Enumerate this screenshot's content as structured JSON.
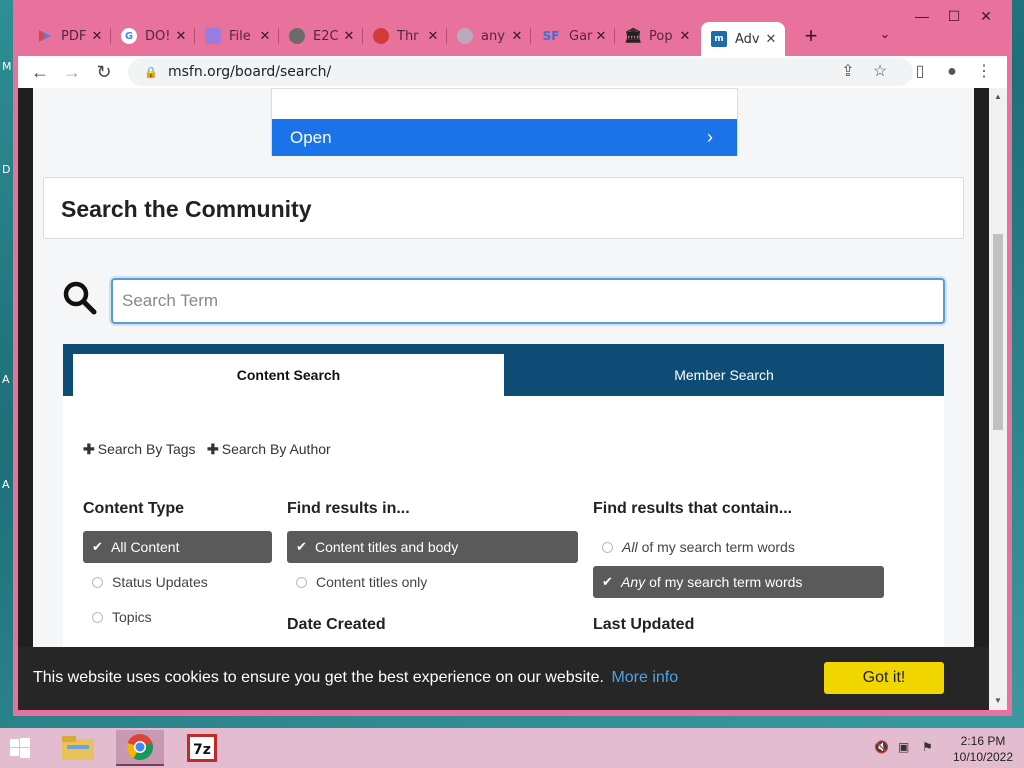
{
  "desktop": {
    "letters": [
      "M",
      "D",
      "A",
      "A"
    ]
  },
  "browser": {
    "tabs": [
      {
        "label": "PDF",
        "icon": "pdf-icon",
        "color": "#e8453c"
      },
      {
        "label": "DO!",
        "icon": "google-icon",
        "color": "#4285f4"
      },
      {
        "label": "File",
        "icon": "file-icon",
        "color": "#9a7be0"
      },
      {
        "label": "E2C",
        "icon": "globe-icon",
        "color": "#6b6b6b"
      },
      {
        "label": "Thr",
        "icon": "thread-icon",
        "color": "#d33b3b"
      },
      {
        "label": "any",
        "icon": "loading-icon",
        "color": "#9a8fa0"
      },
      {
        "label": "Gar",
        "icon": "sf-icon",
        "color": "#3b6fd8",
        "prefix": "SF"
      },
      {
        "label": "Pop",
        "icon": "bank-icon",
        "color": "#333333"
      },
      {
        "label": "Adv",
        "icon": "msfn-icon",
        "color": "#1b6ca8",
        "active": true
      }
    ],
    "url": "msfn.org/board/search/"
  },
  "ad": {
    "button_label": "Open"
  },
  "page": {
    "title": "Search the Community",
    "search": {
      "placeholder": "Search Term"
    },
    "tabs": {
      "content": "Content Search",
      "member": "Member Search"
    },
    "links": {
      "tags": "Search By Tags",
      "author": "Search By Author"
    },
    "content_type": {
      "title": "Content Type",
      "options": [
        "All Content",
        "Status Updates",
        "Topics"
      ],
      "selected": 0
    },
    "find_in": {
      "title": "Find results in...",
      "options": [
        "Content titles and body",
        "Content titles only"
      ],
      "selected": 0
    },
    "contain": {
      "title": "Find results that contain...",
      "opt1_em": "All",
      "opt1_rest": "of my search term words",
      "opt2_em": "Any",
      "opt2_rest": "of my search term words",
      "selected": 1
    },
    "date_created": "Date Created",
    "last_updated": "Last Updated"
  },
  "cookie": {
    "text": "This website uses cookies to ensure you get the best experience on our website.",
    "link": "More info",
    "button": "Got it!"
  },
  "taskbar": {
    "time": "2:16 PM",
    "date": "10/10/2022"
  }
}
